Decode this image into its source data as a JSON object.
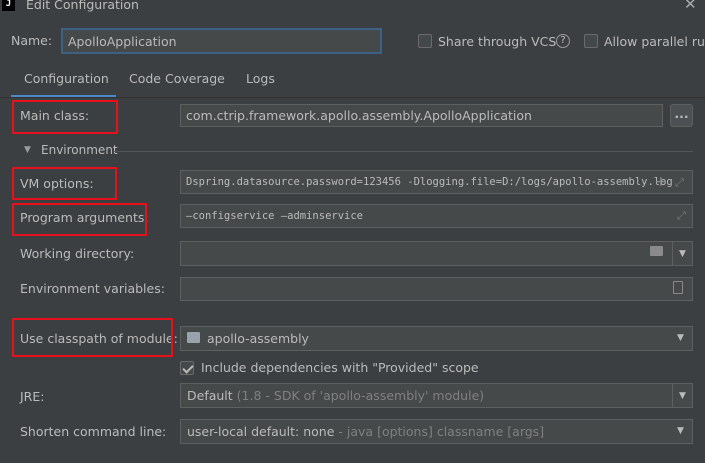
{
  "window": {
    "title": "Edit Configuration",
    "close_glyph": "✕",
    "app_icon_letter": "J"
  },
  "header": {
    "name_label": "Name:",
    "name_value": "ApolloApplication",
    "share_vcs_label": "Share through VCS",
    "allow_parallel_label": "Allow parallel run",
    "help_glyph": "?"
  },
  "tabs": [
    {
      "label": "Configuration",
      "active": true
    },
    {
      "label": "Code Coverage",
      "active": false
    },
    {
      "label": "Logs",
      "active": false
    }
  ],
  "form": {
    "main_class": {
      "label": "Main class:",
      "value": "com.ctrip.framework.apollo.assembly.ApolloApplication",
      "button": "..."
    },
    "environment_section": "Environment",
    "vm_options": {
      "label": "VM options:",
      "value": "Dspring.datasource.password=123456 -Dlogging.file=D:/logs/apollo-assembly.log"
    },
    "program_arguments": {
      "label": "Program arguments:",
      "value": "—configservice —adminservice"
    },
    "working_directory": {
      "label": "Working directory:",
      "value": ""
    },
    "environment_variables": {
      "label": "Environment variables:",
      "value": ""
    },
    "classpath_module": {
      "label": "Use classpath of module:",
      "value": "apollo-assembly"
    },
    "include_provided": {
      "label": "Include dependencies with \"Provided\" scope",
      "checked": true
    },
    "jre": {
      "label": "JRE:",
      "value": "Default",
      "detail": "(1.8 - SDK of 'apollo-assembly' module)"
    },
    "shorten_command_line": {
      "label": "Shorten command line:",
      "value": "user-local default: none",
      "detail": "- java [options] classname [args]"
    }
  },
  "colors": {
    "background": "#3c3f41",
    "field": "#45494a",
    "highlight": "#e8101a",
    "tab_accent": "#4a88c7"
  }
}
